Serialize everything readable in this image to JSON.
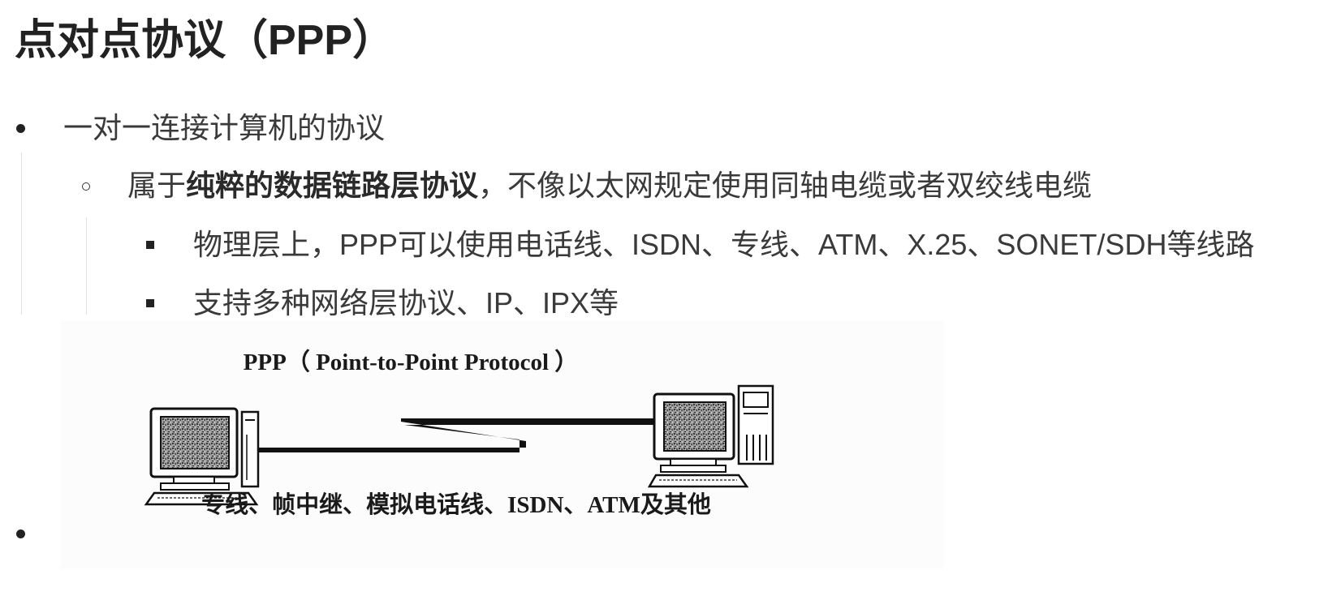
{
  "page": {
    "title": "点对点协议（PPP）"
  },
  "bullets": [
    {
      "text": "一对一连接计算机的协议",
      "children": [
        {
          "prefix": "属于",
          "strong": "纯粹的数据链路层协议",
          "suffix": "，不像以太网规定使用同轴电缆或者双绞线电缆",
          "children": [
            {
              "text": "物理层上，PPP可以使用电话线、ISDN、专线、ATM、X.25、SONET/SDH等线路"
            },
            {
              "text": "支持多种网络层协议、IP、IPX等"
            }
          ]
        }
      ]
    },
    {
      "text": ""
    }
  ],
  "figure": {
    "caption_top": "PPP（ Point-to-Point Protocol ）",
    "caption_bottom": "专线、帧中继、模拟电话线、ISDN、ATM及其他"
  }
}
